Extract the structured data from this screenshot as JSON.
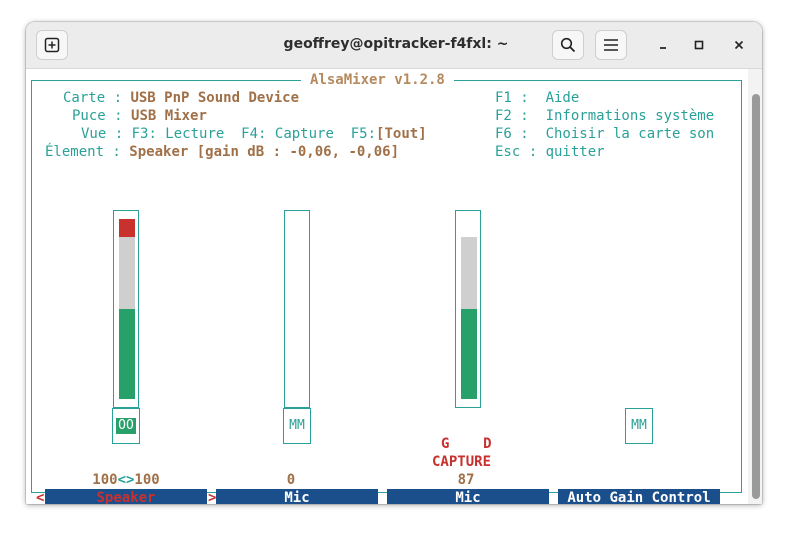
{
  "window": {
    "title": "geoffrey@opitracker-f4fxl: ~"
  },
  "header_icons": {
    "new_tab": "new-tab-icon",
    "search": "search-icon",
    "menu": "hamburger-menu-icon",
    "minimize": "minimize-icon",
    "maximize": "maximize-icon",
    "close": "close-icon"
  },
  "mixer": {
    "title": "AlsaMixer v1.2.8",
    "info": {
      "card_label": "Carte :",
      "card_value": "USB PnP Sound Device",
      "chip_label": "Puce :",
      "chip_value": "USB Mixer",
      "view_label": "Vue :",
      "view_f3": "F3: Lecture",
      "view_f4": "F4: Capture",
      "view_f5_key": "F5:",
      "view_f5_value": "[Tout]",
      "element_label": "Élement :",
      "element_value": "Speaker [gain dB : -0,06, -0,06]"
    },
    "keys": {
      "f1": "F1 :  Aide",
      "f2": "F2 :  Informations système",
      "f6": "F6 :  Choisir la carte son",
      "esc": "Esc : quitter"
    },
    "controls": [
      {
        "name": "Speaker",
        "level": "100<>100",
        "level_left": "100",
        "level_sep": "<>",
        "level_right": "100",
        "switch": "OO",
        "volume_percent": 100,
        "selected": true
      },
      {
        "name": "Mic",
        "level": "0",
        "switch": "MM",
        "volume_percent": 0
      },
      {
        "name": "Mic",
        "level": "87",
        "capture_flags": "G    D",
        "capture_label": "CAPTURE",
        "volume_percent": 87
      },
      {
        "name": "Auto Gain Control",
        "switch": "MM"
      }
    ],
    "selection_left": "<",
    "selection_right": ">"
  },
  "colors": {
    "accent": "#2aa198",
    "brown_text": "#a07048",
    "label_bg": "#1b4f8c",
    "green_fill": "#27a169",
    "gray_fill": "#cfcfcf",
    "red_fill": "#c8312e"
  }
}
